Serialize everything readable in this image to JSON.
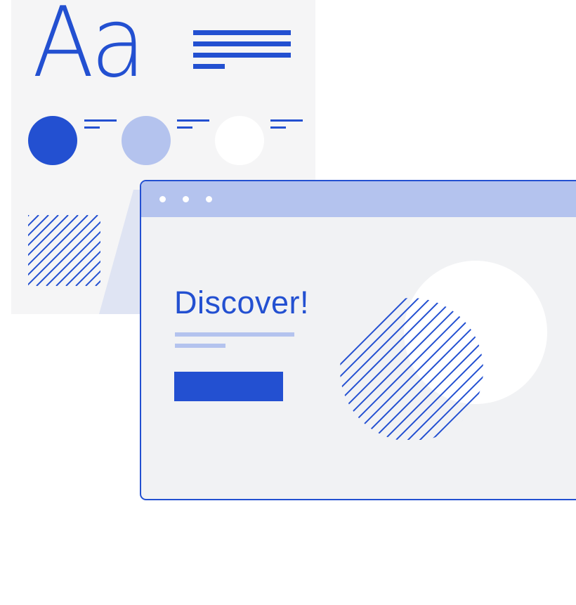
{
  "style_sheet": {
    "typeface_sample": "Aa",
    "text_lines_icon": "text-lines-icon",
    "swatches": [
      {
        "name": "primary-color-swatch",
        "color": "#2350d1"
      },
      {
        "name": "secondary-color-swatch",
        "color": "#b4c3ee"
      },
      {
        "name": "background-color-swatch",
        "color": "#ffffff"
      }
    ],
    "pattern_swatch": "diagonal-hatch-pattern"
  },
  "browser": {
    "title_bar_dots": 3,
    "hero": {
      "heading": "Discover!",
      "cta_label": ""
    },
    "hero_graphic": "hatched-circle-over-white-circle"
  },
  "colors": {
    "primary": "#2350d1",
    "secondary": "#b4c3ee",
    "sheet_background": "#f5f5f6",
    "window_background": "#f1f2f4",
    "beam": "#dfe4f3",
    "white": "#ffffff"
  }
}
